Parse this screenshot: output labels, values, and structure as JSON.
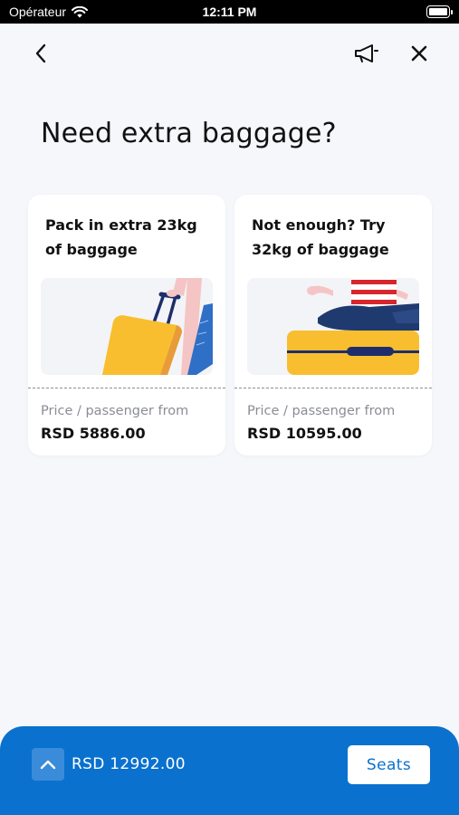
{
  "status_bar": {
    "carrier": "Opérateur",
    "time": "12:11 PM"
  },
  "header": {
    "back_icon": "chevron-left-icon",
    "announce_icon": "megaphone-icon",
    "close_icon": "close-icon"
  },
  "page": {
    "title": "Need extra baggage?"
  },
  "cards": [
    {
      "title": "Pack in extra 23kg of baggage",
      "price_label": "Price / passenger from",
      "price": "RSD 5886.00",
      "illustration": "suitcase-icon"
    },
    {
      "title": "Not enough? Try 32kg of baggage",
      "price_label": "Price / passenger from",
      "price": "RSD 10595.00",
      "illustration": "person-on-suitcase-icon"
    }
  ],
  "footer": {
    "expand_icon": "chevron-up-icon",
    "total": "RSD 12992.00",
    "action_label": "Seats"
  },
  "colors": {
    "brand_blue": "#0a71ce",
    "suitcase_yellow": "#f9be2f",
    "background": "#f6f7fa"
  }
}
